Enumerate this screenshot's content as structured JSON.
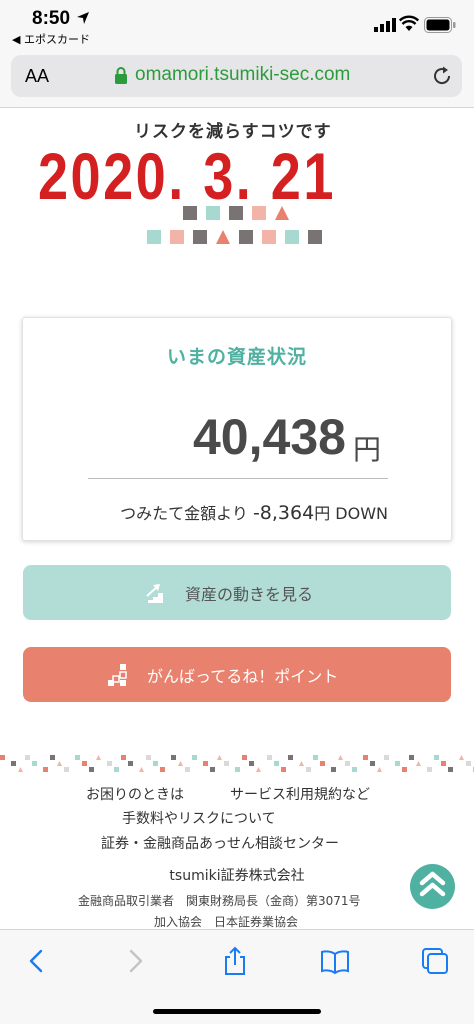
{
  "status_bar": {
    "time": "8:50",
    "back_app": "◀ エポスカード"
  },
  "address_bar": {
    "aa_label": "AA",
    "url": "omamori.tsumiki-sec.com"
  },
  "banner": {
    "subtitle": "リスクを減らすコツです",
    "date": "2020. 3. 21"
  },
  "asset_card": {
    "title": "いまの資産状況",
    "amount": "40,438",
    "currency": "円",
    "diff_prefix": "つみたて金額より",
    "diff_value": "-8,364",
    "diff_unit": "円",
    "diff_direction": "DOWN"
  },
  "buttons": {
    "trend_label": "資産の動きを見る",
    "point_label": "がんばってるね！ポイント"
  },
  "footer": {
    "help": "お困りのときは",
    "terms": "サービス利用規約など",
    "fees": "手数料やリスクについて",
    "consult": "証券・金融商品あっせん相談センター",
    "company": "tsumiki証券株式会社",
    "registration": "金融商品取引業者　関東財務局長（金商）第3071号",
    "association": "加入協会　日本証券業協会"
  },
  "colors": {
    "accent_teal": "#4fb1a1",
    "button_teal": "#b2ddd6",
    "button_coral": "#e8816d",
    "date_red": "#d42020",
    "url_green": "#2c9b3c"
  },
  "icons": {
    "trend": "stairs-up-icon",
    "point": "blocks-icon",
    "scroll_top": "chevron-up-icon"
  }
}
